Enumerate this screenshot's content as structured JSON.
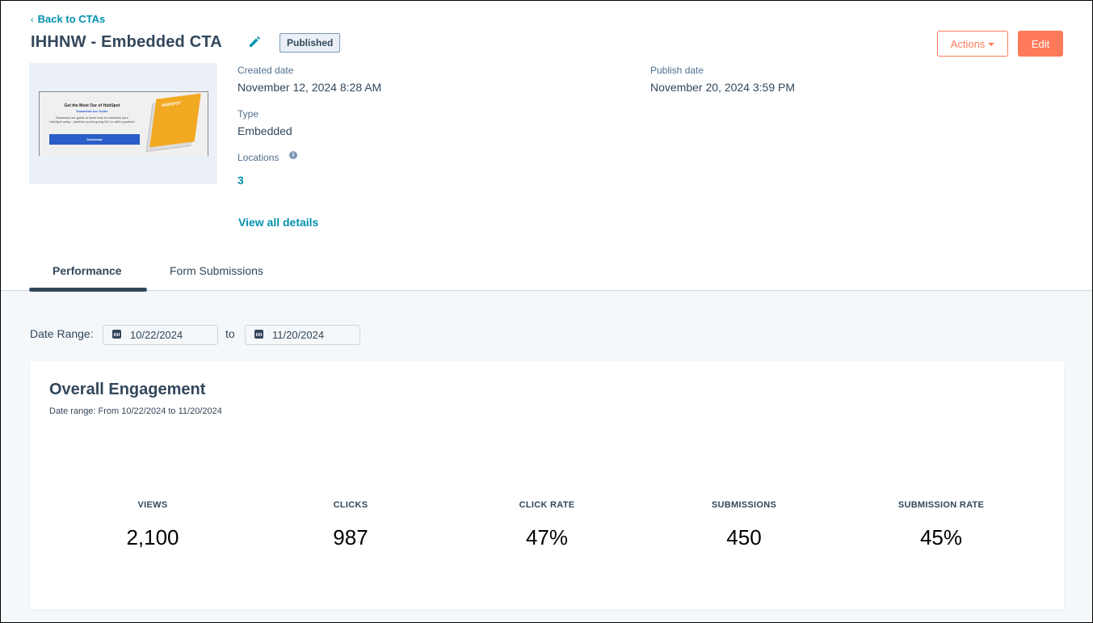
{
  "header": {
    "back_label": "Back to CTAs",
    "title": "IHHNW - Embedded CTA",
    "status_badge": "Published",
    "actions_label": "Actions",
    "edit_label": "Edit"
  },
  "thumbnail": {
    "heading": "Get the Most Our of HubSpot",
    "subheading": "Download our Guide",
    "body": "Download our guide to learn how to maximize your HubSpot setup - whether you're going DIY or with a partner!",
    "button_label": "Download",
    "book_title": "HUBSPOT"
  },
  "details": {
    "created_label": "Created date",
    "created_value": "November 12, 2024 8:28 AM",
    "publish_label": "Publish date",
    "publish_value": "November 20, 2024 3:59 PM",
    "type_label": "Type",
    "type_value": "Embedded",
    "locations_label": "Locations",
    "locations_value": "3",
    "view_all_label": "View all details"
  },
  "tabs": [
    {
      "label": "Performance",
      "active": true
    },
    {
      "label": "Form Submissions",
      "active": false
    }
  ],
  "date_range": {
    "label": "Date Range:",
    "from": "10/22/2024",
    "to_label": "to",
    "to": "11/20/2024"
  },
  "engagement": {
    "title": "Overall Engagement",
    "subtitle": "Date range: From 10/22/2024 to 11/20/2024",
    "stats": [
      {
        "label": "VIEWS",
        "value": "2,100"
      },
      {
        "label": "CLICKS",
        "value": "987"
      },
      {
        "label": "CLICK RATE",
        "value": "47%"
      },
      {
        "label": "SUBMISSIONS",
        "value": "450"
      },
      {
        "label": "SUBMISSION RATE",
        "value": "45%"
      }
    ]
  },
  "colors": {
    "accent": "#ff7a59",
    "link": "#0091ae",
    "text": "#33475b"
  }
}
